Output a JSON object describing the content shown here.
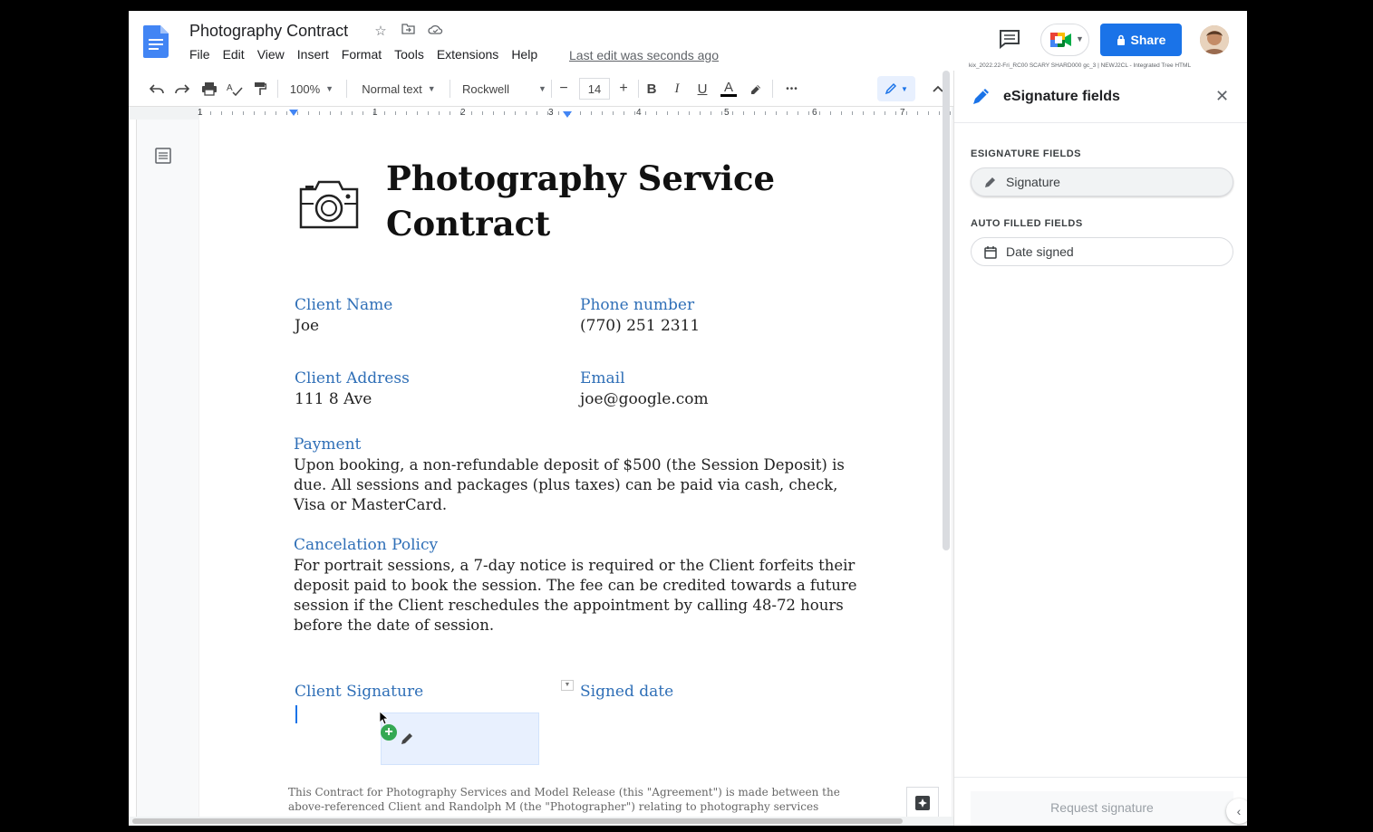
{
  "doc": {
    "title": "Photography Contract",
    "menu": [
      "File",
      "Edit",
      "View",
      "Insert",
      "Format",
      "Tools",
      "Extensions",
      "Help"
    ],
    "last_edit": "Last edit was seconds ago",
    "share_label": "Share",
    "build_tag": "kix_2022.22-Fri_RC00 SCARY SHARD000 gc_3 | NEWJ2CL - Integrated Tree HTML"
  },
  "toolbar": {
    "zoom": "100%",
    "style": "Normal text",
    "font": "Rockwell",
    "font_size": "14",
    "bold": "B",
    "italic": "I",
    "underline": "U",
    "text_color": "A",
    "more": "•••"
  },
  "ruler": [
    "1",
    "1",
    "2",
    "3",
    "4",
    "5",
    "6",
    "7"
  ],
  "content": {
    "heading": "Photography Service Contract",
    "heading_line1": "Photography Service",
    "heading_line2": "Contract",
    "client_name_label": "Client Name",
    "client_name": "Joe",
    "phone_label": "Phone number",
    "phone": "(770) 251 2311",
    "address_label": "Client Address",
    "address": "111 8 Ave",
    "email_label": "Email",
    "email": "joe@google.com",
    "payment_label": "Payment",
    "payment_text": "Upon booking, a non-refundable deposit of $500 (the Session Deposit) is due. All sessions and packages (plus taxes) can be paid via cash, check, Visa or MasterCard.",
    "cancel_label": "Cancelation Policy",
    "cancel_text": "For portrait sessions, a 7-day notice is required or the Client forfeits their deposit paid to book the session. The fee can be credited towards a future session if the Client reschedules the appointment by calling 48-72 hours before the date of session.",
    "signature_label": "Client Signature",
    "signed_date_label": "Signed date",
    "footer_text": "This Contract for Photography Services and Model Release (this \"Agreement\") is made between the above-referenced Client and Randolph M (the \"Photographer\") relating to photography services"
  },
  "panel": {
    "title": "eSignature fields",
    "esig_section": "ESIGNATURE FIELDS",
    "signature_chip": "Signature",
    "auto_section": "AUTO FILLED FIELDS",
    "date_chip": "Date signed",
    "request_button": "Request signature"
  },
  "colors": {
    "accent": "#1a73e8",
    "heading_blue": "#2f6fb7",
    "docs_blue": "#4285f4"
  }
}
